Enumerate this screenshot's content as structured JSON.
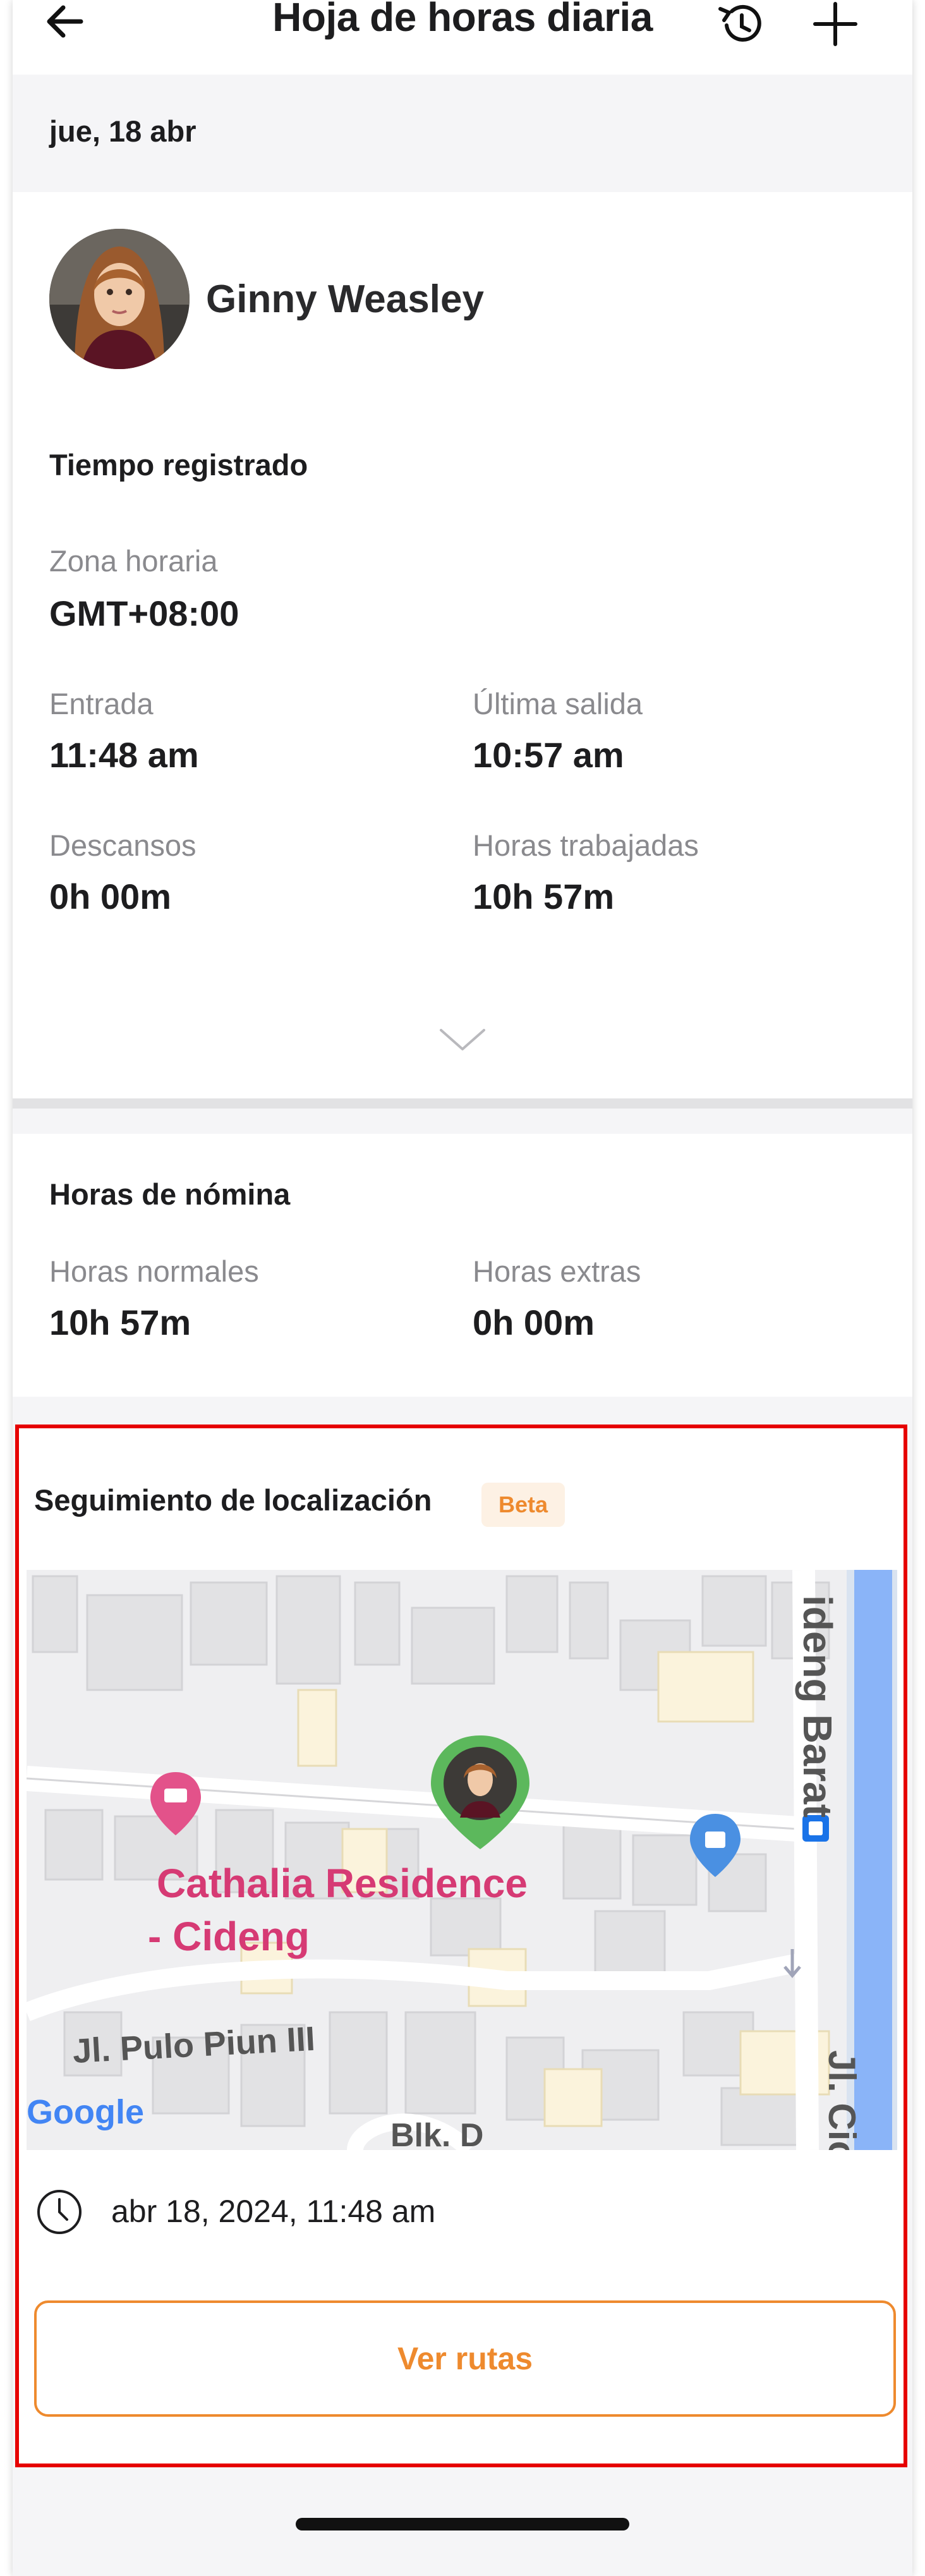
{
  "header": {
    "title": "Hoja de horas diaria",
    "back_icon": "arrow-left-icon",
    "history_icon": "history-icon",
    "add_icon": "plus-icon"
  },
  "date": "jue, 18 abr",
  "employee": {
    "name": "Ginny Weasley"
  },
  "tracked_time": {
    "title": "Tiempo registrado",
    "timezone_label": "Zona horaria",
    "timezone_value": "GMT+08:00",
    "clock_in_label": "Entrada",
    "clock_in_value": "11:48 am",
    "last_out_label": "Última salida",
    "last_out_value": "10:57 am",
    "breaks_label": "Descansos",
    "breaks_value": "0h 00m",
    "worked_label": "Horas trabajadas",
    "worked_value": "10h 57m"
  },
  "payroll": {
    "title": "Horas de nómina",
    "regular_label": "Horas normales",
    "regular_value": "10h 57m",
    "overtime_label": "Horas extras",
    "overtime_value": "0h 00m"
  },
  "location": {
    "title": "Seguimiento de localización",
    "badge": "Beta",
    "map": {
      "poi_line1": "Cathalia Residence",
      "poi_line2": "- Cideng",
      "street1": "Jl. Pulo Piun III",
      "street2": "Jl. Cideng Barat",
      "street2_visible": "ideng Barat",
      "street3": "Jl. Cic",
      "block": "Blk. D",
      "logo": "Google"
    },
    "timestamp": "abr 18, 2024, 11:48 am",
    "routes_button": "Ver rutas"
  },
  "colors": {
    "accent": "#ee8a2e",
    "highlight_border": "#e60000",
    "pin": "#5cb85c",
    "poi": "#d63a74",
    "water": "#8ab4f8"
  }
}
